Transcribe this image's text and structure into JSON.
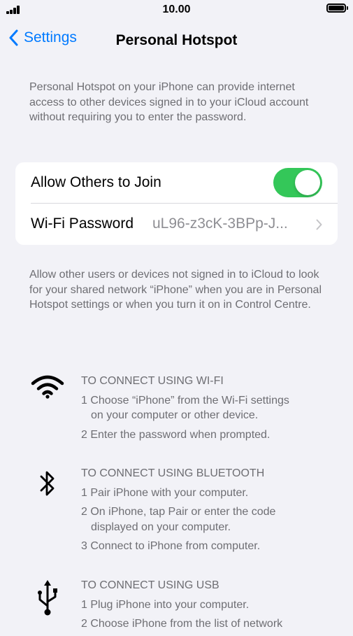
{
  "status": {
    "time": "10.00"
  },
  "nav": {
    "back_label": "Settings",
    "title": "Personal Hotspot"
  },
  "intro": "Personal Hotspot on your iPhone can provide internet access to other devices signed in to your iCloud account without requiring you to enter the password.",
  "settings": {
    "allow_label": "Allow Others to Join",
    "allow_on": true,
    "accent_color": "#34c759",
    "wifi_label": "Wi-Fi Password",
    "wifi_value": "uL96-z3cK-3BPp-J..."
  },
  "footer": "Allow other users or devices not signed in to iCloud to look for your shared network “iPhone” when you are in Personal Hotspot settings or when you turn it on in Control Centre.",
  "wifi_section": {
    "icon": "wifi-icon",
    "heading": "TO CONNECT USING WI-FI",
    "step1_a": "1 Choose “iPhone” from the Wi-Fi settings",
    "step1_b": "on your computer or other device.",
    "step2": "2 Enter the password when prompted."
  },
  "bluetooth_section": {
    "icon": "bluetooth-icon",
    "heading": "TO CONNECT USING BLUETOOTH",
    "step1": "1 Pair iPhone with your computer.",
    "step2_a": "2 On iPhone, tap Pair or enter the code",
    "step2_b": "displayed on your computer.",
    "step3": "3 Connect to iPhone from computer."
  },
  "usb_section": {
    "icon": "usb-icon",
    "heading": "TO CONNECT USING USB",
    "step1": "1 Plug iPhone into your computer.",
    "step2_a": "2 Choose iPhone from the list of network"
  }
}
